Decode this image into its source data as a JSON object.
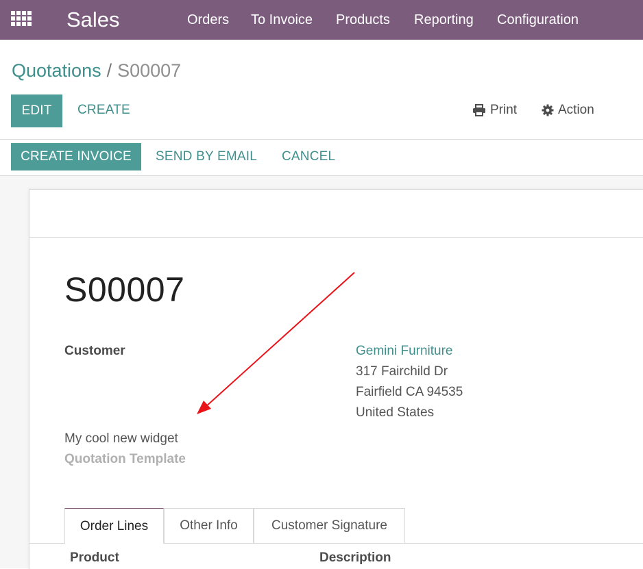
{
  "navbar": {
    "app_title": "Sales",
    "items": [
      {
        "label": "Orders"
      },
      {
        "label": "To Invoice"
      },
      {
        "label": "Products"
      },
      {
        "label": "Reporting"
      },
      {
        "label": "Configuration"
      }
    ],
    "color": "#7c5c7c"
  },
  "breadcrumb": {
    "parent": "Quotations",
    "separator": "/",
    "current": "S00007"
  },
  "toolbar": {
    "edit_label": "EDIT",
    "create_label": "CREATE",
    "print_label": "Print",
    "action_label": "Action",
    "print_icon": "printer-icon",
    "action_icon": "gear-icon"
  },
  "statusbar": {
    "create_invoice_label": "CREATE INVOICE",
    "send_email_label": "SEND BY EMAIL",
    "cancel_label": "CANCEL"
  },
  "form": {
    "order_name": "S00007",
    "customer_label": "Customer",
    "customer_name": "Gemini Furniture",
    "address_lines": [
      "317 Fairchild Dr",
      "Fairfield CA 94535",
      "United States"
    ],
    "widget_text": "My cool new widget",
    "quotation_template_label": "Quotation Template"
  },
  "tabs": [
    {
      "label": "Order Lines",
      "active": true
    },
    {
      "label": "Other Info",
      "active": false
    },
    {
      "label": "Customer Signature",
      "active": false
    }
  ],
  "order_lines": {
    "columns": [
      "Product",
      "Description"
    ]
  },
  "colors": {
    "accent": "#4d9c98",
    "link": "#3f8f8c",
    "annotation_arrow": "#e8141a"
  }
}
